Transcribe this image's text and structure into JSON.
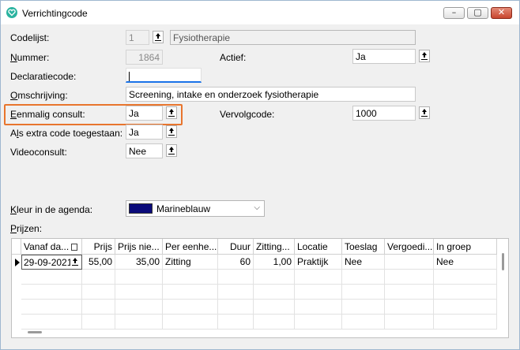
{
  "window": {
    "title": "Verrichtingcode",
    "controls": [
      "minimize",
      "maximize",
      "close"
    ]
  },
  "form": {
    "codelijst_label": "Codelijst:",
    "codelijst_value": "1",
    "codelijst_name": "Fysiotherapie",
    "nummer_label": "Nummer:",
    "nummer_value": "1864",
    "actief_label": "Actief:",
    "actief_value": "Ja",
    "declaratiecode_label": "Declaratiecode:",
    "declaratiecode_value": "",
    "omschrijving_label": "Omschrijving:",
    "omschrijving_value": "Screening, intake en onderzoek fysiotherapie",
    "eenmalig_label": "Eenmalig consult:",
    "eenmalig_value": "Ja",
    "vervolgcode_label": "Vervolgcode:",
    "vervolgcode_value": "1000",
    "extra_label": "Als extra code toegestaan:",
    "extra_value": "Ja",
    "video_label": "Videoconsult:",
    "video_value": "Nee",
    "kleur_label": "Kleur in de agenda:",
    "kleur_value": "Marineblauw",
    "kleur_color": "#0b0b7a",
    "prijzen_label": "Prijzen:"
  },
  "prices_table": {
    "columns": [
      "Vanaf da...",
      "Prijs",
      "Prijs nie...",
      "Per eenhe...",
      "Duur",
      "Zitting...",
      "Locatie",
      "Toeslag",
      "Vergoedi...",
      "In groep"
    ],
    "rows": [
      [
        "29-09-2021",
        "55,00",
        "35,00",
        "Zitting",
        "60",
        "1,00",
        "Praktijk",
        "Nee",
        "",
        "Nee"
      ]
    ]
  },
  "colors": {
    "highlight": "#e8752d",
    "accent_underline": "#1a73e8"
  }
}
